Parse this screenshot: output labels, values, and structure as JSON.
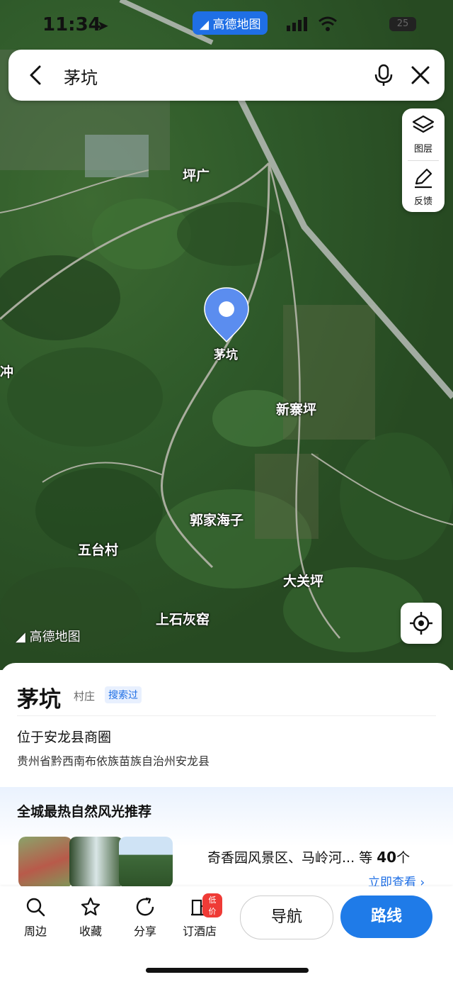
{
  "status_bar": {
    "time": "11:34",
    "brand": "高德地图",
    "battery": "25"
  },
  "search": {
    "query": "茅坑"
  },
  "side_panel": {
    "layers_label": "图层",
    "feedback_label": "反馈"
  },
  "map": {
    "pin_label": "茅坑",
    "labels": {
      "pingguang": "坪广",
      "xinzhaiping": "新寨坪",
      "guojiahaizi": "郭家海子",
      "wutaicun": "五台村",
      "daguanping": "大关坪",
      "shangshihuiyao": "上石灰窑",
      "edge_chong": "冲"
    },
    "watermark": "高德地图"
  },
  "place": {
    "name": "茅坑",
    "type": "村庄",
    "tag": "搜索过",
    "district": "位于安龙县商圈",
    "address": "贵州省黔西南布依族苗族自治州安龙县"
  },
  "recommendation": {
    "title": "全城最热自然风光推荐",
    "summary_prefix": "奇香园风景区、马岭河... 等",
    "count": "40",
    "summary_suffix": "个",
    "view_all": "立即查看 ›"
  },
  "toolbar": {
    "nearby": "周边",
    "favorite": "收藏",
    "share": "分享",
    "hotel": "订酒店",
    "hotel_badge": "低价",
    "navigate": "导航",
    "route": "路线"
  },
  "colors": {
    "accent": "#1f7be8",
    "badge": "#ef3b36"
  }
}
